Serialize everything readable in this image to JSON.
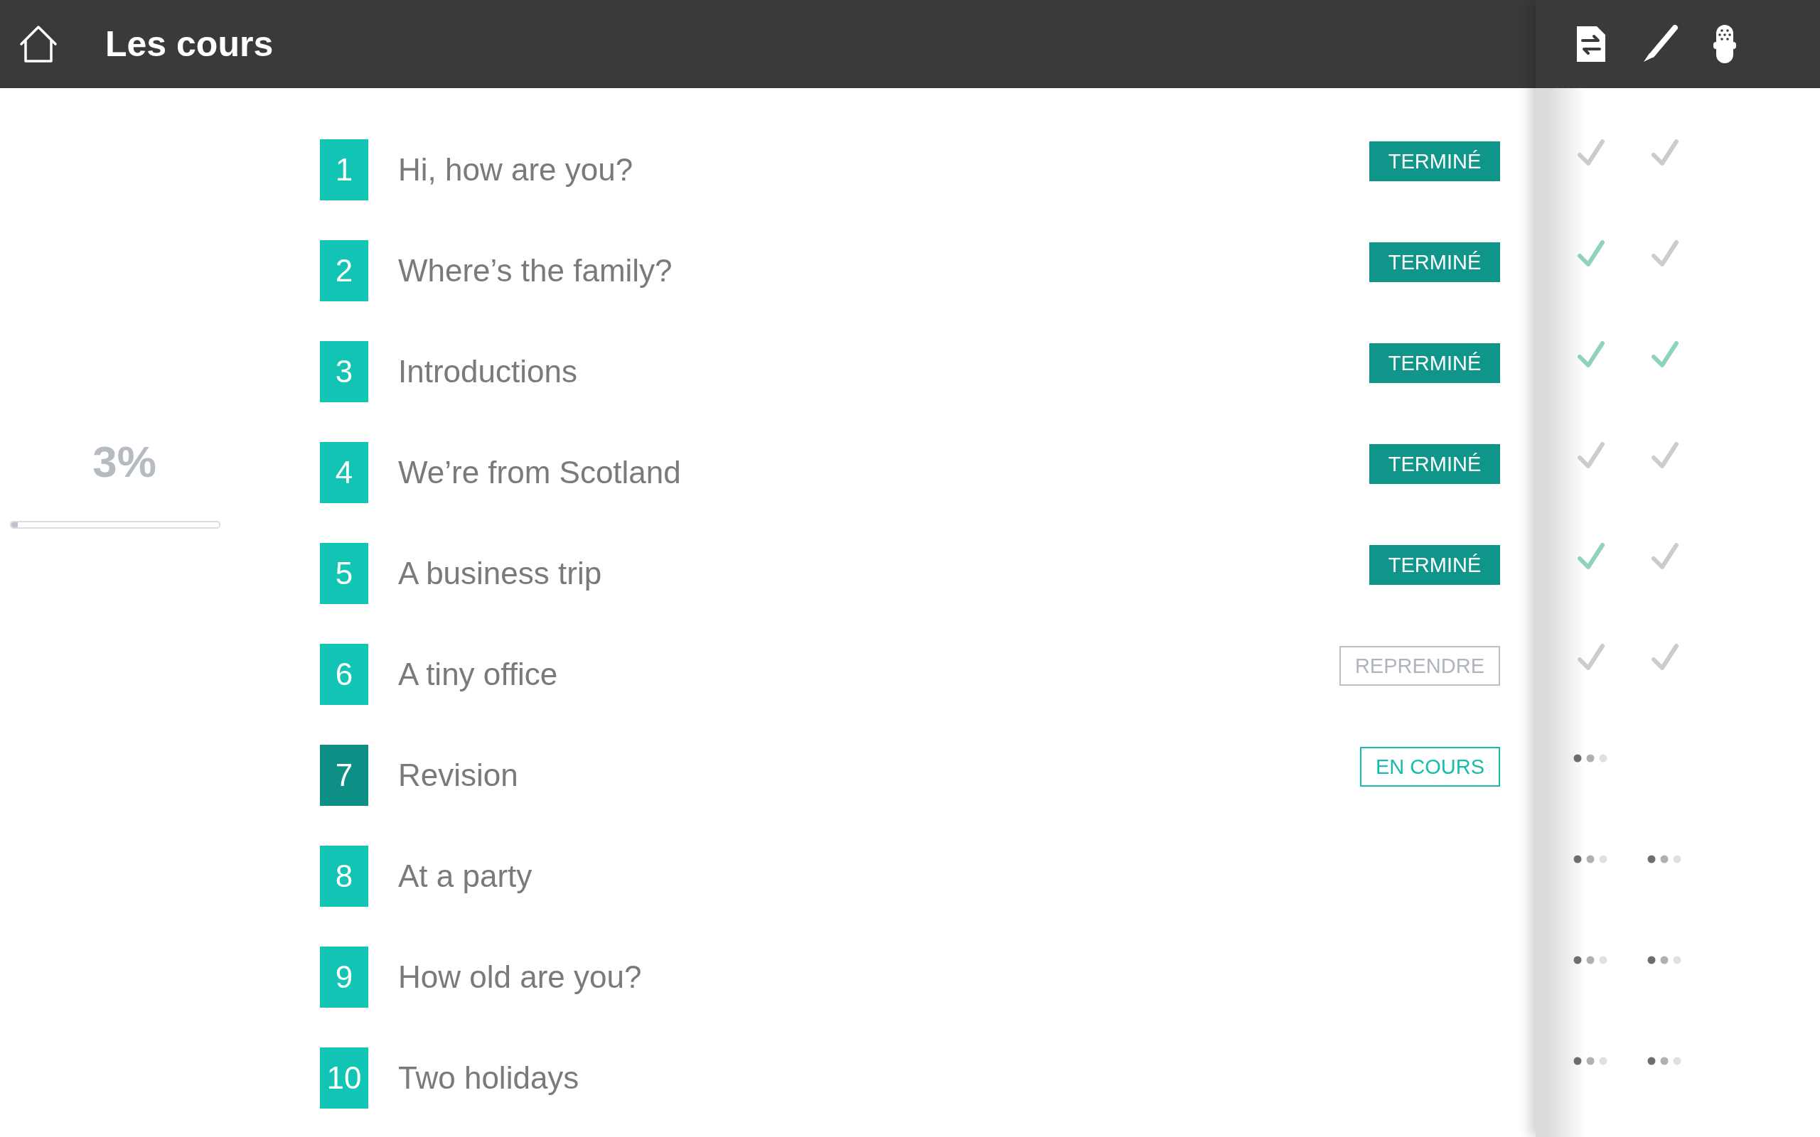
{
  "header": {
    "title": "Les cours"
  },
  "progress": {
    "reading": "3%",
    "level": 0.03
  },
  "lessons": [
    {
      "number": "1",
      "title": "Hi, how are you?",
      "selected": false,
      "status": {
        "kind": "done",
        "label": "TERMINÉ"
      },
      "marks": [
        {
          "kind": "check",
          "done": false
        },
        {
          "kind": "check",
          "done": false
        }
      ]
    },
    {
      "number": "2",
      "title": "Where’s the family?",
      "selected": false,
      "status": {
        "kind": "done",
        "label": "TERMINÉ"
      },
      "marks": [
        {
          "kind": "check",
          "done": true
        },
        {
          "kind": "check",
          "done": false
        }
      ]
    },
    {
      "number": "3",
      "title": "Introductions",
      "selected": false,
      "status": {
        "kind": "done",
        "label": "TERMINÉ"
      },
      "marks": [
        {
          "kind": "check",
          "done": true
        },
        {
          "kind": "check",
          "done": true
        }
      ]
    },
    {
      "number": "4",
      "title": "We’re from Scotland",
      "selected": false,
      "status": {
        "kind": "done",
        "label": "TERMINÉ"
      },
      "marks": [
        {
          "kind": "check",
          "done": false
        },
        {
          "kind": "check",
          "done": false
        }
      ]
    },
    {
      "number": "5",
      "title": "A business trip",
      "selected": false,
      "status": {
        "kind": "done",
        "label": "TERMINÉ"
      },
      "marks": [
        {
          "kind": "check",
          "done": true
        },
        {
          "kind": "check",
          "done": false
        }
      ]
    },
    {
      "number": "6",
      "title": "A tiny office",
      "selected": false,
      "status": {
        "kind": "resume",
        "label": "REPRENDRE"
      },
      "marks": [
        {
          "kind": "check",
          "done": false
        },
        {
          "kind": "check",
          "done": false
        }
      ]
    },
    {
      "number": "7",
      "title": "Revision",
      "selected": true,
      "status": {
        "kind": "current",
        "label": "EN COURS"
      },
      "marks": [
        {
          "kind": "pending"
        }
      ]
    },
    {
      "number": "8",
      "title": "At a party",
      "selected": false,
      "marks": [
        {
          "kind": "pending"
        },
        {
          "kind": "pending"
        }
      ]
    },
    {
      "number": "9",
      "title": "How old are you?",
      "selected": false,
      "marks": [
        {
          "kind": "pending"
        },
        {
          "kind": "pending"
        }
      ]
    },
    {
      "number": "10",
      "title": "Two holidays",
      "selected": false,
      "marks": [
        {
          "kind": "pending"
        },
        {
          "kind": "pending"
        }
      ]
    }
  ]
}
